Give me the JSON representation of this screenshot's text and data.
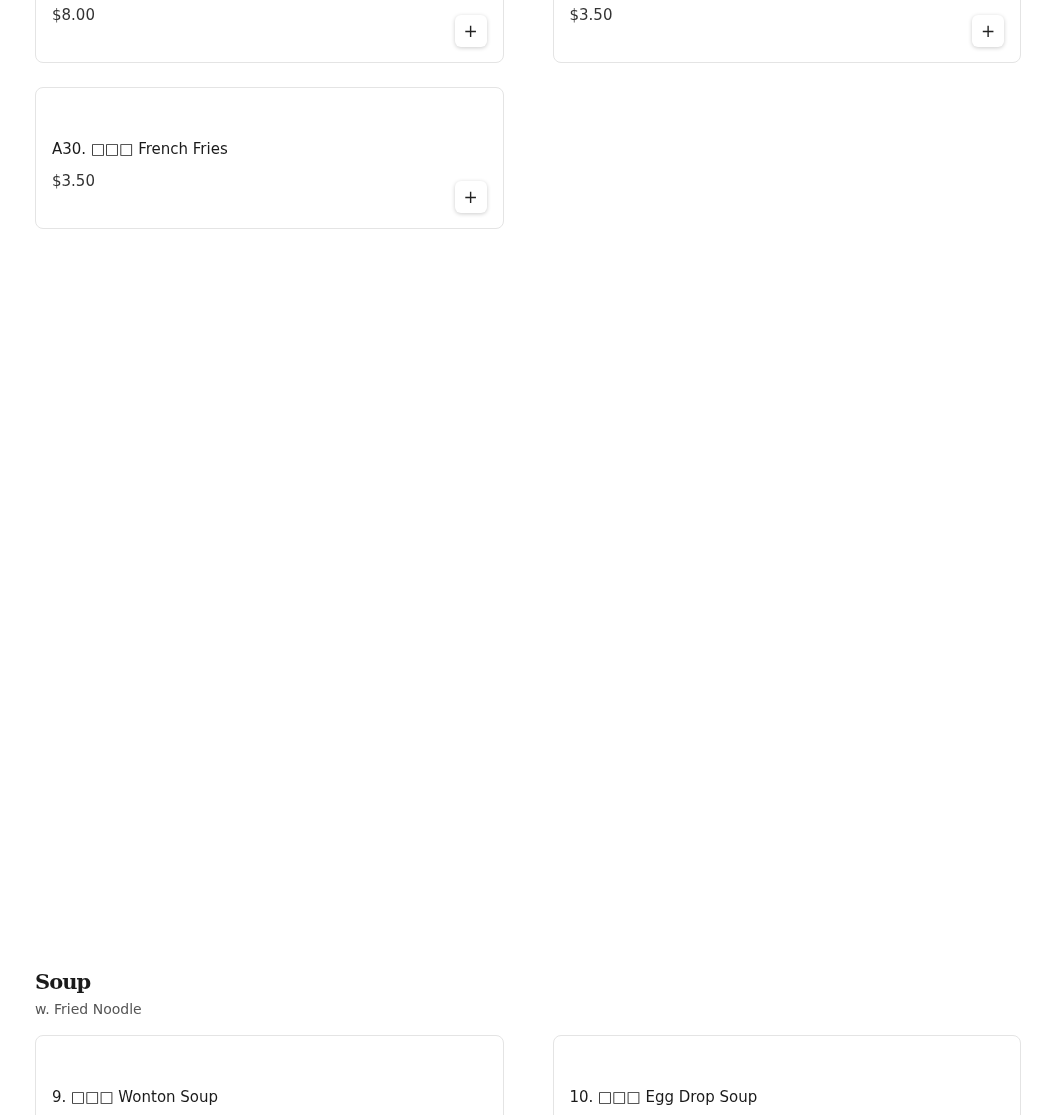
{
  "sections": [
    {
      "items": [
        {
          "price": "$8.00",
          "add_label": "+"
        },
        {
          "price": "$3.50",
          "add_label": "+"
        },
        {
          "name": "A30. □□□ French Fries",
          "price": "$3.50",
          "add_label": "+"
        }
      ]
    },
    {
      "title": "Soup",
      "subtitle": "w. Fried Noodle",
      "items": [
        {
          "name": "9. □□□ Wonton Soup"
        },
        {
          "name": "10. □□□ Egg Drop Soup"
        }
      ]
    }
  ]
}
